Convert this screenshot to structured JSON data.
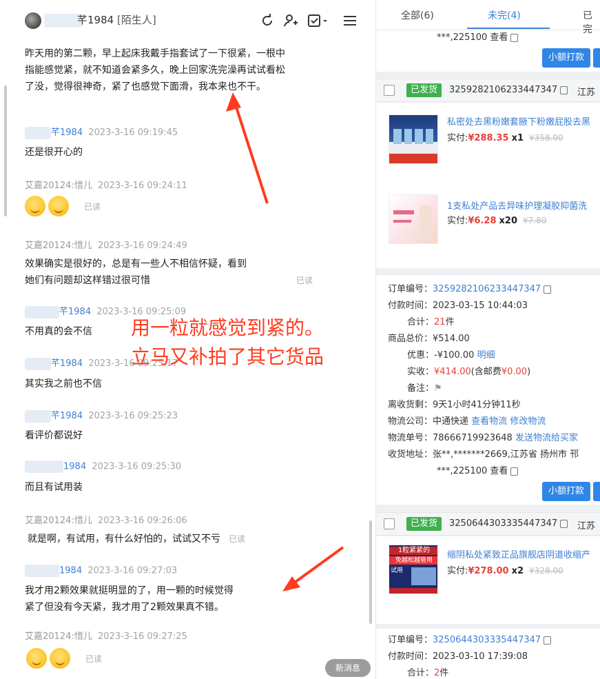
{
  "chat": {
    "header": {
      "title": "⁡⁢⁣1984 [陌生人]",
      "name_suffix": "芊1984",
      "tag": "[陌生人]"
    },
    "messages": {
      "m0_text": "昨天用的第二颗，早上起床我戴手指套试了一下很紧，一根中指能感觉紧，就不知道会紧多久，晚上回家洗完澡再试试看松了没，觉得很神奇，紧了也感觉下面滑，我本来也不干。",
      "m1_name": "芊1984",
      "m1_time": "2023-3-16 09:19:45",
      "m1_text": "还是很开心的",
      "m2_name": "艾嘉20124:惜儿",
      "m2_time": "2023-3-16 09:24:11",
      "m2_read": "已读",
      "m3_name": "艾嘉20124:惜儿",
      "m3_time": "2023-3-16 09:24:49",
      "m3_text_1": "效果确实是很好的，总是有一些人不相信怀疑，看到",
      "m3_text_2": "她们有问题却这样错过很可惜",
      "m3_read": "已读",
      "m4_name": "芊1984",
      "m4_time": "2023-3-16 09:25:09",
      "m4_text": "不用真的会不信",
      "m5_name": "芊1984",
      "m5_time": "2023-3-16 09:25:17",
      "m5_text": "其实我之前也不信",
      "m6_name": "芊1984",
      "m6_time": "2023-3-16 09:25:23",
      "m6_text": "看评价都说好",
      "m7_name": "1984",
      "m7_time": "2023-3-16 09:25:30",
      "m7_text": "而且有试用装",
      "m8_name": "艾嘉20124:惜儿",
      "m8_time": "2023-3-16 09:26:06",
      "m8_text": "就是啊，有试用，有什么好怕的，试试又不亏",
      "m8_read": "已读",
      "m9_name": "1984",
      "m9_time": "2023-3-16 09:27:03",
      "m9_text_1": "我才用2颗效果就挺明显的了，用一颗的时候觉得",
      "m9_text_2": "紧了但没有今天紧，我才用了2颗效果真不错。",
      "m10_name": "艾嘉20124:惜儿",
      "m10_time": "2023-3-16 09:27:25",
      "m10_read": "已读"
    },
    "overlay_line1": "用一粒就感觉到紧的。",
    "overlay_line2": "立马又补拍了其它货品",
    "new_message": "新消息"
  },
  "orders": {
    "tabs": [
      "全部(6)",
      "未完(4)",
      "已完"
    ],
    "top": {
      "addr_tail": "***,225100 查看",
      "pay_btn": "小额打款"
    },
    "o1": {
      "status": "已发货",
      "no": "3259282106233447347",
      "city": "江苏",
      "p1_name": "私密处去黑粉嫩套腋下粉嫩屁股去黑",
      "p1_label": "实付:",
      "p1_price": "¥288.35",
      "p1_qty": "x1",
      "p1_orig": "¥358.00",
      "p2_name": "1支私处产品去异味护理凝胶抑菌洗",
      "p2_label": "实付:",
      "p2_price": "¥6.28",
      "p2_qty": "x20",
      "p2_orig": "¥7.80",
      "order_no_label": "订单编号：",
      "order_no": "3259282106233447347",
      "pay_time": "付款时间：2023-03-15 10:44:03",
      "total_label": "合计：",
      "total_val": "21",
      "total_unit": "件",
      "goods_total": "商品总价：¥514.00",
      "discount_label": "优惠：-¥100.00",
      "discount_link": "明细",
      "paid_label": "实收：",
      "paid_val": "¥414.00",
      "paid_ship": "(含邮费",
      "paid_ship_val": "¥0.00",
      "paid_close": ")",
      "remark": "备注：",
      "countdown": "离收货剩：9天1小时41分钟11秒",
      "logistics_label": "物流公司：中通快递",
      "logistics_view": "查看物流",
      "logistics_edit": "修改物流",
      "tracking_label": "物流单号：78666719923648",
      "tracking_send": "发送物流给买家",
      "address": "收货地址：张**,*******2669,江苏省 扬州市 邗",
      "address_tail": "***,225100 查看",
      "pay_btn": "小额打款"
    },
    "o2": {
      "status": "已发货",
      "no": "3250644303335447347",
      "city": "江苏",
      "p1_name": "缩阴私处紧致正品旗舰店阴道收缩产",
      "p1_label": "实付:",
      "p1_price": "¥278.00",
      "p1_qty": "x2",
      "p1_orig": "¥328.00",
      "thumb_text_1": "1粒紧紧的",
      "thumb_text_2": "免越松越管用",
      "thumb_text_3": "试用",
      "order_no_label": "订单编号：",
      "order_no": "3250644303335447347",
      "pay_time": "付款时间：2023-03-10 17:39:08",
      "total_label": "合计：",
      "total_val": "2",
      "total_unit": "件"
    }
  },
  "colors": {
    "accent": "#3d7fd3",
    "red": "#e8403a",
    "green": "#3fb04d",
    "overlay": "#ff3b1f"
  }
}
